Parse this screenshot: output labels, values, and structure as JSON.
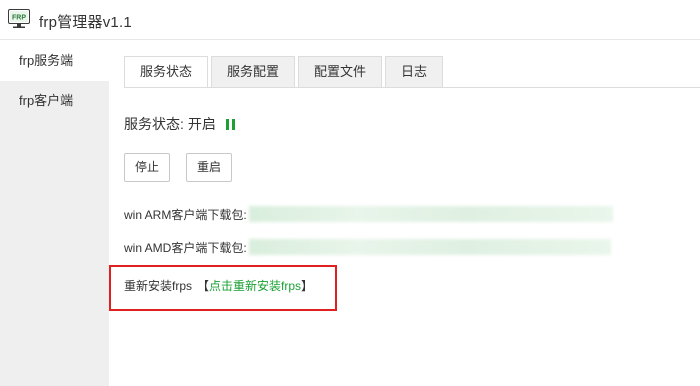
{
  "app": {
    "icon_text": "FRP",
    "title": "frp管理器v1.1"
  },
  "sidebar": {
    "items": [
      {
        "label": "frp服务端",
        "active": true
      },
      {
        "label": "frp客户端",
        "active": false
      }
    ]
  },
  "tabs": [
    {
      "label": "服务状态",
      "active": true
    },
    {
      "label": "服务配置",
      "active": false
    },
    {
      "label": "配置文件",
      "active": false
    },
    {
      "label": "日志",
      "active": false
    }
  ],
  "status": {
    "label": "服务状态:",
    "value": "开启",
    "indicator_icon": "pause-icon",
    "indicator_color": "#1aa034"
  },
  "buttons": {
    "stop": "停止",
    "restart": "重启"
  },
  "downloads": [
    {
      "label": "win ARM客户端下载包:"
    },
    {
      "label": "win AMD客户端下载包:"
    }
  ],
  "reinstall": {
    "label": "重新安装frps",
    "bracket_open": "【",
    "link": "点击重新安装frps",
    "bracket_close": "】",
    "highlight_color": "#e0201f",
    "link_color": "#1aa034"
  }
}
